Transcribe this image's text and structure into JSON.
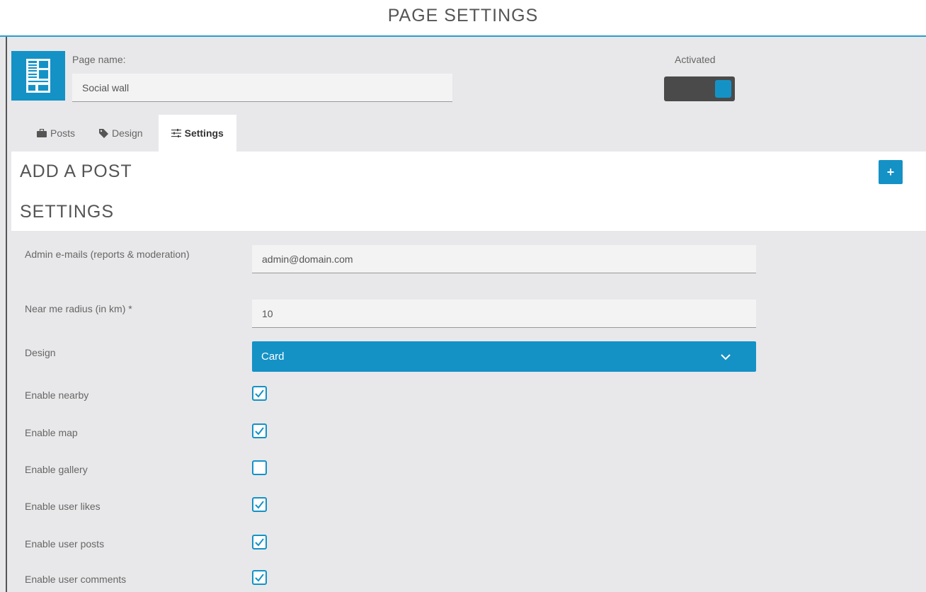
{
  "header": {
    "title": "PAGE SETTINGS"
  },
  "page": {
    "icon": "page-layout-icon",
    "name_label": "Page name:",
    "name_value": "Social wall",
    "activated_label": "Activated",
    "activated": true
  },
  "tabs": [
    {
      "label": "Posts",
      "icon": "briefcase-icon",
      "active": false
    },
    {
      "label": "Design",
      "icon": "tag-icon",
      "active": false
    },
    {
      "label": "Settings",
      "icon": "sliders-icon",
      "active": true
    }
  ],
  "sections": {
    "add_post_title": "ADD A POST",
    "add_button_label": "+",
    "settings_title": "SETTINGS"
  },
  "settings": {
    "admin_emails_label": "Admin e-mails (reports & moderation)",
    "admin_emails_value": "admin@domain.com",
    "radius_label": "Near me radius (in km) *",
    "radius_value": "10",
    "design_label": "Design",
    "design_value": "Card",
    "checkboxes": [
      {
        "label": "Enable nearby",
        "checked": true
      },
      {
        "label": "Enable map",
        "checked": true
      },
      {
        "label": "Enable gallery",
        "checked": false
      },
      {
        "label": "Enable user likes",
        "checked": true
      },
      {
        "label": "Enable user posts",
        "checked": true
      },
      {
        "label": "Enable user comments",
        "checked": true
      }
    ]
  },
  "colors": {
    "accent": "#1492c6",
    "background": "#e8e8ea",
    "toggle_track": "#4a4a4a"
  }
}
